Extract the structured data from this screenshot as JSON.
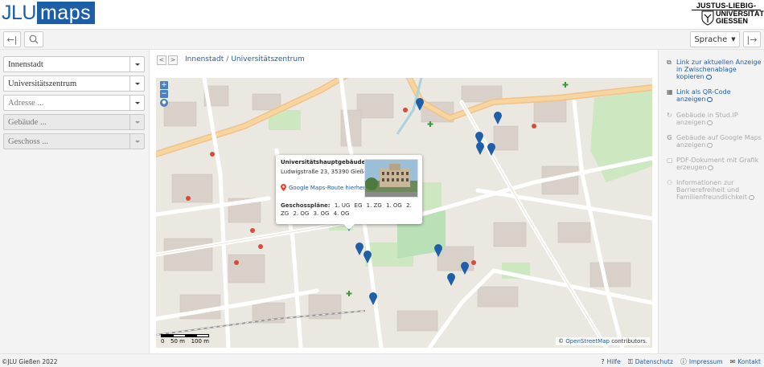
{
  "header": {
    "logo_left": "JLU",
    "logo_right": "maps",
    "uni_line1": "JUSTUS-LIEBIG-",
    "uni_line2": "UNIVERSITÄT",
    "uni_line3": "GIESSEN"
  },
  "toolbar": {
    "back_icon": "←|",
    "language_label": "Sprache",
    "expand_icon": "|→"
  },
  "sidebar": {
    "selects": [
      {
        "value": "Innenstadt"
      },
      {
        "value": "Universitätszentrum"
      },
      {
        "value": "Adresse ..."
      },
      {
        "value": "Gebäude ..."
      },
      {
        "value": "Geschoss ..."
      }
    ]
  },
  "main": {
    "prev_arrow": "<",
    "next_arrow": ">",
    "breadcrumb": [
      "Innenstadt",
      "Universitätszentrum"
    ],
    "breadcrumb_sep": "/"
  },
  "map": {
    "zoom_in": "+",
    "zoom_out": "−",
    "attribution_prefix": "©",
    "attribution_link": "OpenStreetMap",
    "attribution_suffix": "contributors.",
    "scale_0": "0",
    "scale_50": "50 m",
    "scale_100": "100 m",
    "popup": {
      "title": "Universitätshauptgebäude",
      "address": "Ludwigstraße 23, 35390 Gießen",
      "route_link": "Google Maps-Route hierher",
      "floors_label": "Geschosspläne:",
      "floors": [
        "1. UG",
        "EG",
        "1. ZG",
        "1. OG",
        "2. ZG",
        "2. OG",
        "3. OG",
        "4. OG"
      ]
    }
  },
  "rightbar": {
    "items": [
      {
        "icon": "copy-link-icon",
        "label": "Link zur aktuellen Anzeige in Zwischenablage kopieren",
        "enabled": true
      },
      {
        "icon": "qr-code-icon",
        "label": "Link als QR-Code anzeigen",
        "enabled": true
      },
      {
        "icon": "studip-icon",
        "label": "Gebäude in Stud.IP anzeigen",
        "enabled": false
      },
      {
        "icon": "google-icon",
        "label": "Gebäude auf Google Maps anzeigen",
        "enabled": false
      },
      {
        "icon": "pdf-icon",
        "label": "PDF-Dokument mit Grafik erzeugen",
        "enabled": false
      },
      {
        "icon": "accessibility-icon",
        "label": "Informationen zur Barrierefreiheit und Familienfreundlichkeit",
        "enabled": false
      }
    ]
  },
  "footer": {
    "copyright": "©JLU Gießen 2022",
    "links": [
      "Hilfe",
      "Datenschutz",
      "Impressum",
      "Kontakt"
    ]
  },
  "colors": {
    "brand": "#1d5ea8",
    "road_major": "#f5c783",
    "marker": "#1f5fa8"
  }
}
